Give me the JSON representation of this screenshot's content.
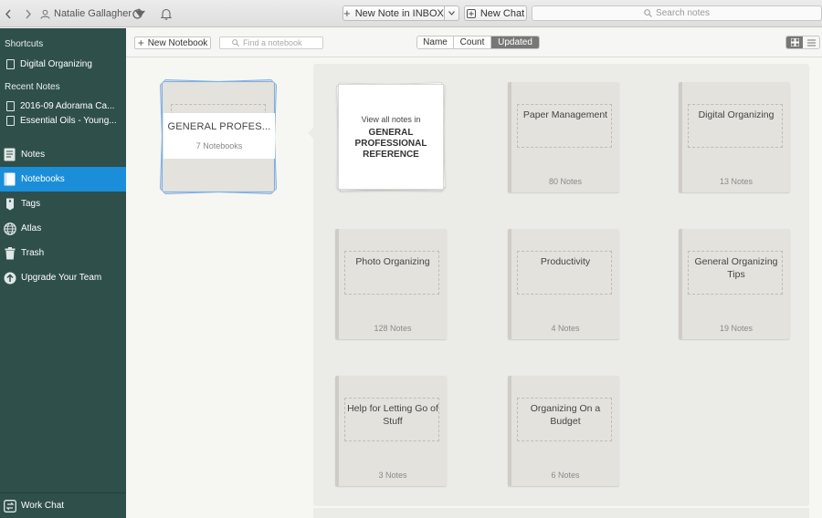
{
  "toolbar": {
    "back_icon": "chevron-left-icon",
    "forward_icon": "chevron-right-icon",
    "user_name": "Natalie Gallagher",
    "new_note_label": "New Note in INBOX",
    "new_chat_label": "New Chat",
    "search_placeholder": "Search notes"
  },
  "sidebar": {
    "shortcuts_heading": "Shortcuts",
    "shortcuts": [
      {
        "label": "Digital Organizing"
      }
    ],
    "recent_heading": "Recent Notes",
    "recent": [
      {
        "label": "2016-09 Adorama Ca..."
      },
      {
        "label": "Essential Oils - Young..."
      }
    ],
    "main": [
      {
        "label": "Notes",
        "icon": "notes-icon"
      },
      {
        "label": "Notebooks",
        "icon": "notebook-icon",
        "active": true
      },
      {
        "label": "Tags",
        "icon": "tag-icon"
      },
      {
        "label": "Atlas",
        "icon": "globe-icon"
      },
      {
        "label": "Trash",
        "icon": "trash-icon"
      },
      {
        "label": "Upgrade Your Team",
        "icon": "upgrade-arrow-icon"
      }
    ],
    "work_chat_label": "Work Chat"
  },
  "content_header": {
    "new_notebook_label": "New Notebook",
    "find_placeholder": "Find a notebook",
    "sort": [
      {
        "label": "Name",
        "active": false
      },
      {
        "label": "Count",
        "active": false
      },
      {
        "label": "Updated",
        "active": true
      }
    ],
    "view_mode": "grid"
  },
  "stack": {
    "title": "GENERAL PROFES...",
    "count": "7 Notebooks"
  },
  "view_all": {
    "prefix": "View all notes in",
    "name_line1": "GENERAL",
    "name_line2": "PROFESSIONAL",
    "name_line3": "REFERENCE"
  },
  "notebooks": [
    {
      "name": "Paper Management",
      "count": "80 Notes"
    },
    {
      "name": "Digital Organizing",
      "count": "13 Notes"
    },
    {
      "name": "Photo Organizing",
      "count": "128 Notes"
    },
    {
      "name": "Productivity",
      "count": "4 Notes"
    },
    {
      "name": "General Organizing Tips",
      "count": "19 Notes"
    },
    {
      "name": "Help for Letting Go of Stuff",
      "count": "3 Notes"
    },
    {
      "name": "Organizing On a Budget",
      "count": "6 Notes"
    }
  ],
  "colors": {
    "sidebar_bg": "#2f4f4a",
    "active_blue": "#1a8ed8",
    "stack_border": "#7fb0e6"
  }
}
